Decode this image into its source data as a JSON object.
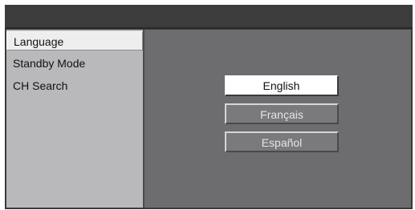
{
  "sidebar": {
    "items": [
      {
        "label": "Language"
      },
      {
        "label": "Standby Mode"
      },
      {
        "label": "CH Search"
      }
    ]
  },
  "languages": {
    "options": [
      {
        "label": "English",
        "selected": true
      },
      {
        "label": "Français",
        "selected": false
      },
      {
        "label": "Español",
        "selected": false
      }
    ]
  }
}
